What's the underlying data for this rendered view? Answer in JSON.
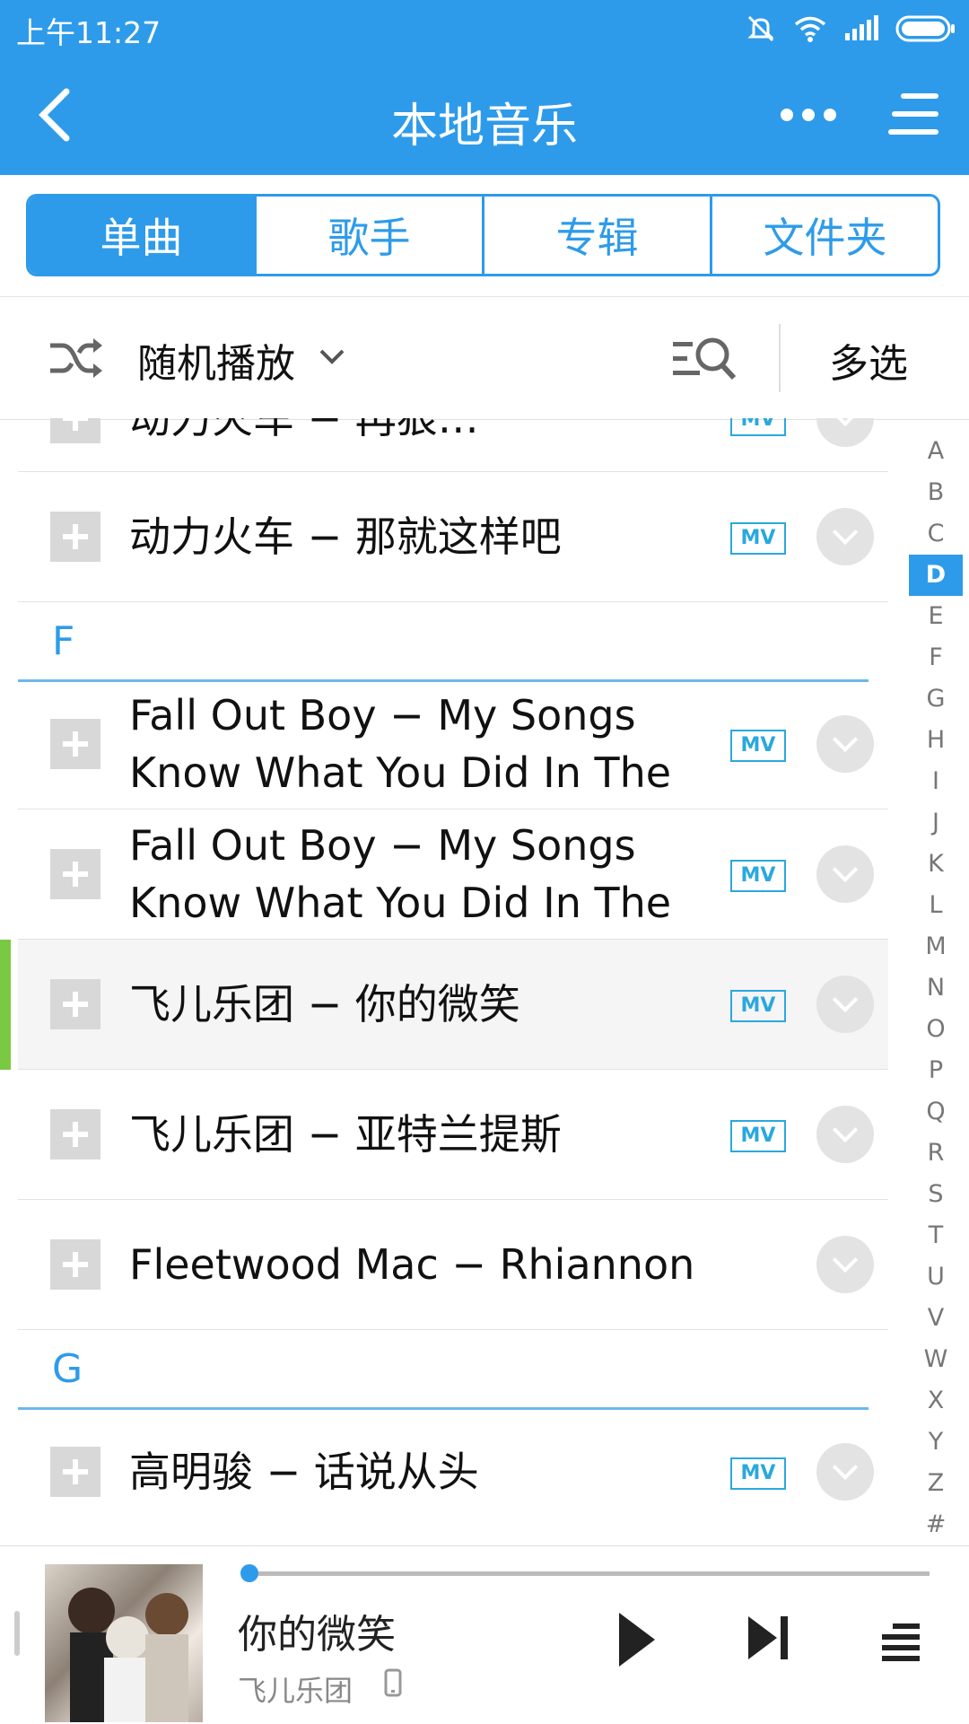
{
  "status": {
    "time": "上午11:27"
  },
  "header": {
    "title": "本地音乐"
  },
  "tabs": [
    "单曲",
    "歌手",
    "专辑",
    "文件夹"
  ],
  "controls": {
    "shuffle_label": "随机播放",
    "multi_select": "多选"
  },
  "list": {
    "top_partial": "动力火车 − 再狠…",
    "rows": [
      {
        "title": "动力火车 − 那就这样吧",
        "mv": "MV"
      },
      {
        "section": "F"
      },
      {
        "title": "Fall Out Boy − My Songs Know What You Did In The",
        "mv": "MV"
      },
      {
        "title": "Fall Out Boy − My Songs Know What You Did In The",
        "mv": "MV"
      },
      {
        "title": "飞儿乐团 − 你的微笑",
        "mv": "MV"
      },
      {
        "title": "飞儿乐团 − 亚特兰提斯",
        "mv": "MV"
      },
      {
        "title": "Fleetwood Mac − Rhiannon",
        "mv": ""
      },
      {
        "section": "G"
      },
      {
        "title": "高明骏 − 话说从头",
        "mv": "MV"
      }
    ]
  },
  "index": [
    "A",
    "B",
    "C",
    "D",
    "E",
    "F",
    "G",
    "H",
    "I",
    "J",
    "K",
    "L",
    "M",
    "N",
    "O",
    "P",
    "Q",
    "R",
    "S",
    "T",
    "U",
    "V",
    "W",
    "X",
    "Y",
    "Z",
    "#"
  ],
  "index_active": "D",
  "player": {
    "song": "你的微笑",
    "artist": "飞儿乐团",
    "progress": 0.0
  },
  "colors": {
    "accent": "#2e9bea",
    "playing_marker": "#7ac943"
  }
}
